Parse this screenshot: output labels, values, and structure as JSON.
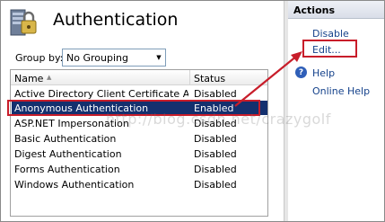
{
  "header": {
    "title": "Authentication",
    "icon": "server-lock-icon"
  },
  "group_by": {
    "label": "Group by:",
    "value": "No Grouping"
  },
  "list": {
    "columns": {
      "name": "Name",
      "status": "Status"
    },
    "rows": [
      {
        "name": "Active Directory Client Certificate Aut...",
        "status": "Disabled"
      },
      {
        "name": "Anonymous Authentication",
        "status": "Enabled"
      },
      {
        "name": "ASP.NET Impersonation",
        "status": "Disabled"
      },
      {
        "name": "Basic Authentication",
        "status": "Disabled"
      },
      {
        "name": "Digest Authentication",
        "status": "Disabled"
      },
      {
        "name": "Forms Authentication",
        "status": "Disabled"
      },
      {
        "name": "Windows Authentication",
        "status": "Disabled"
      }
    ],
    "selected_index": 1
  },
  "actions": {
    "title": "Actions",
    "items": [
      {
        "label": "Disable"
      },
      {
        "label": "Edit..."
      },
      {
        "label": "Help"
      },
      {
        "label": "Online Help"
      }
    ]
  },
  "watermark": "http://blog.csdn.net/crazygolf",
  "colors": {
    "selection": "#14306e",
    "annotation": "#c81d2a",
    "link": "#15428b"
  }
}
